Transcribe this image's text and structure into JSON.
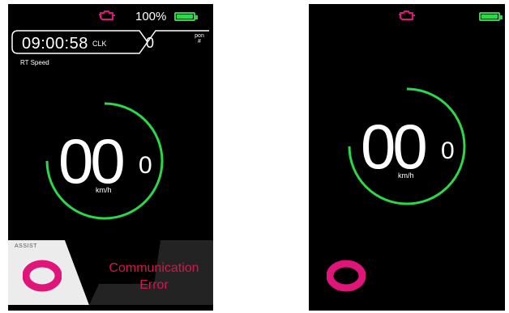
{
  "colors": {
    "accent_green": "#2bd84a",
    "accent_magenta": "#e0157a",
    "error_red": "#d4164f",
    "background": "#000000"
  },
  "left_screen": {
    "status": {
      "engine_icon": "engine-icon",
      "battery_percent": "100%"
    },
    "header": {
      "clock": "09:00:58",
      "clock_unit": "CLK",
      "counter": "0",
      "counter_unit": "pon\n#"
    },
    "speed_mode_label": "RT Speed",
    "speed": {
      "integer": "00",
      "decimal": "0",
      "unit": "km/h",
      "ring_fraction": 0.75
    },
    "assist": {
      "label": "ASSIST",
      "level": "0"
    },
    "error": {
      "line1": "Communication",
      "line2": "Error"
    }
  },
  "right_screen": {
    "status": {
      "engine_icon": "engine-icon"
    },
    "speed": {
      "integer": "00",
      "decimal": "0",
      "unit": "km/h",
      "ring_fraction": 0.75
    },
    "assist": {
      "level": "0"
    }
  }
}
